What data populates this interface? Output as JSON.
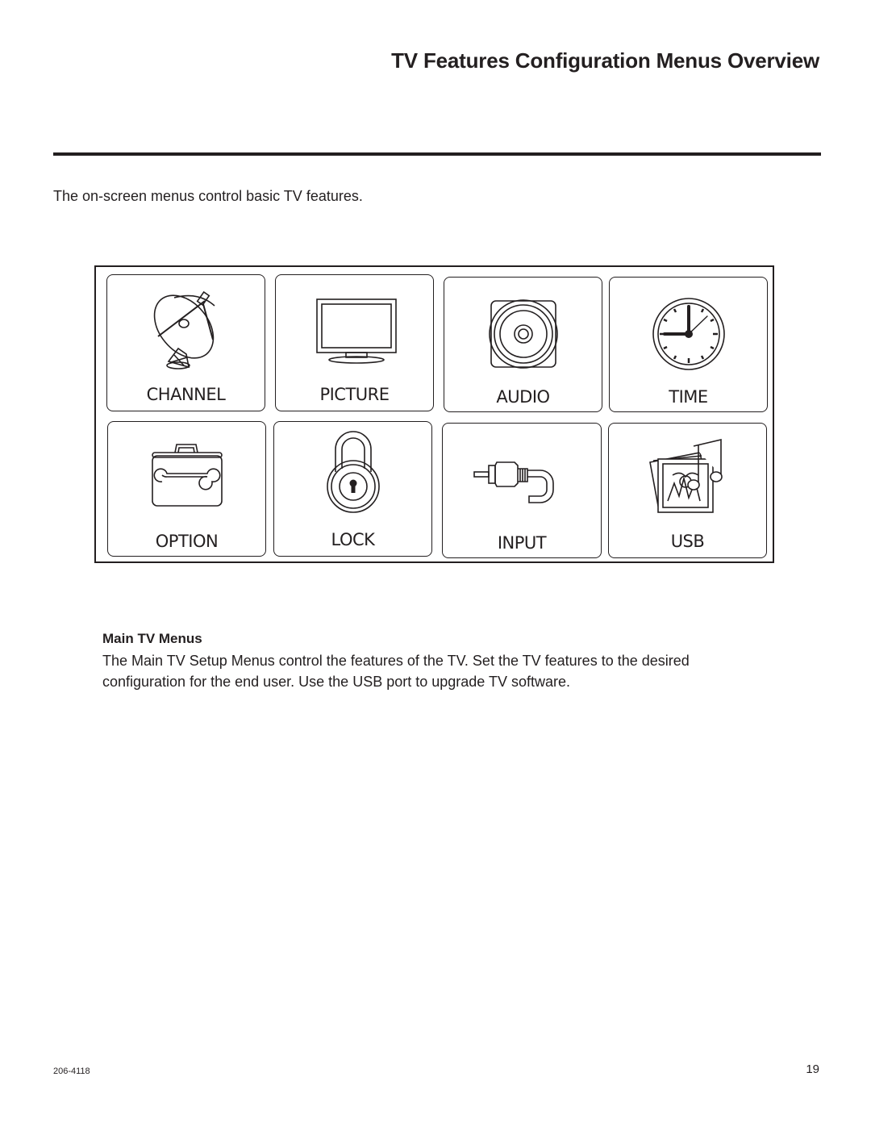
{
  "page": {
    "title": "TV Features Configuration Menus Overview",
    "intro": "The on-screen menus control basic TV features."
  },
  "menu": {
    "tiles": [
      {
        "label": "CHANNEL",
        "icon": "satellite-dish-icon"
      },
      {
        "label": "PICTURE",
        "icon": "tv-monitor-icon"
      },
      {
        "label": "AUDIO",
        "icon": "speaker-icon"
      },
      {
        "label": "TIME",
        "icon": "clock-icon"
      },
      {
        "label": "OPTION",
        "icon": "toolbox-wrench-icon"
      },
      {
        "label": "LOCK",
        "icon": "padlock-icon"
      },
      {
        "label": "INPUT",
        "icon": "rca-cable-icon"
      },
      {
        "label": "USB",
        "icon": "photo-music-icon"
      }
    ]
  },
  "section": {
    "heading": "Main TV Menus",
    "body": "The Main TV Setup Menus control the features of the TV. Set the TV features to the desired configuration for the end user. Use the USB port to upgrade TV software."
  },
  "footer": {
    "doc_code": "206-4118",
    "page_number": "19"
  }
}
